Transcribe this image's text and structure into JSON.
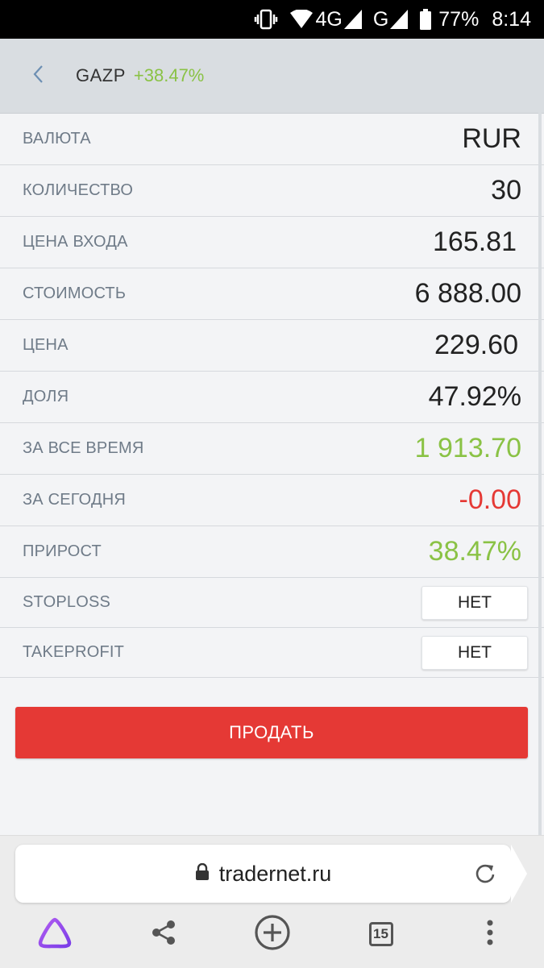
{
  "status_bar": {
    "network": "4G",
    "network2": "G",
    "battery": "77%",
    "time": "8:14"
  },
  "header": {
    "ticker": "GAZP",
    "change": "+38.47%"
  },
  "rows": [
    {
      "label": "ВАЛЮТА",
      "value": "RUR"
    },
    {
      "label": "КОЛИЧЕСТВО",
      "value": "30"
    },
    {
      "label": "ЦЕНА ВХОДА",
      "value": "165.81"
    },
    {
      "label": "СТОИМОСТЬ",
      "value": "6 888.00"
    },
    {
      "label": "ЦЕНА",
      "value": "229.60"
    },
    {
      "label": "ДОЛЯ",
      "value": "47.92%"
    },
    {
      "label": "ЗА ВСЕ ВРЕМЯ",
      "value": "1 913.70"
    },
    {
      "label": "ЗА СЕГОДНЯ",
      "value": "-0.00"
    },
    {
      "label": "ПРИРОСТ",
      "value": "38.47%"
    }
  ],
  "stoploss": {
    "label": "STOPLOSS",
    "button": "НЕТ"
  },
  "takeprofit": {
    "label": "TAKEPROFIT",
    "button": "НЕТ"
  },
  "sell_button": "ПРОДАТЬ",
  "browser": {
    "url": "tradernet.ru",
    "tab_count": "15"
  },
  "colors": {
    "positive": "#8ac245",
    "negative": "#e53935",
    "sell": "#e53935"
  }
}
